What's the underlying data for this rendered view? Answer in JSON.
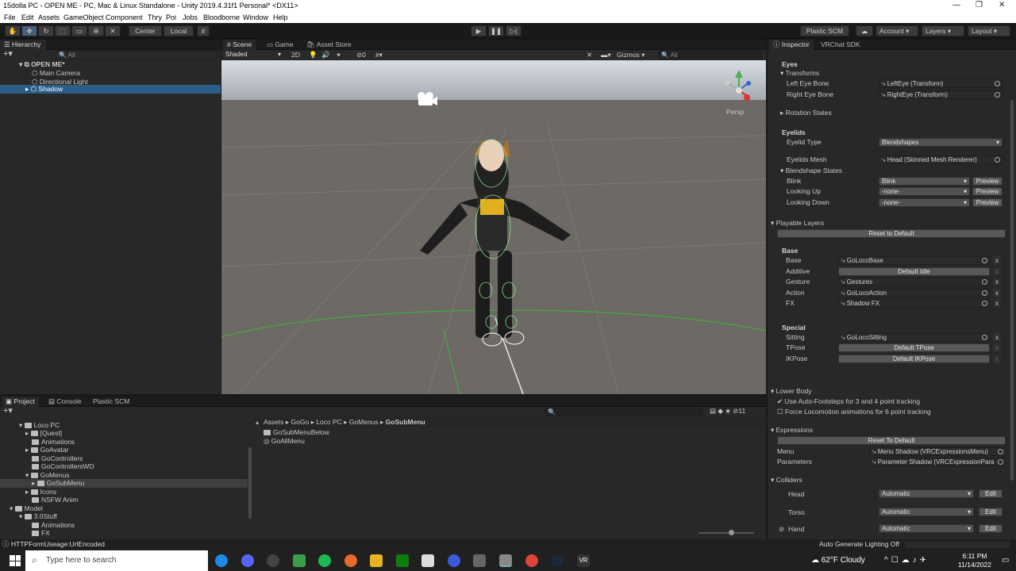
{
  "window": {
    "title": "15dolla PC - OPEN ME - PC, Mac & Linux Standalone - Unity 2019.4.31f1 Personal* <DX11>"
  },
  "menu": [
    "File",
    "Edit",
    "Assets",
    "GameObject",
    "Component",
    "Thry",
    "Poi",
    "Jobs",
    "Bloodborne",
    "Window",
    "Help"
  ],
  "toolbar": {
    "center": "Center",
    "local": "Local",
    "plastic": "Plastic SCM",
    "account": "Account",
    "layers": "Layers",
    "layout": "Layout"
  },
  "hierarchy": {
    "tab": "Hierarchy",
    "search": "All",
    "scene": "OPEN ME*",
    "items": [
      "Main Camera",
      "Directional Light",
      "Shadow"
    ]
  },
  "scene": {
    "tabs": [
      "Scene",
      "Game",
      "Asset Store"
    ],
    "shading": "Shaded",
    "mode2d": "2D",
    "hidden_count": "0",
    "gizmos": "Gizmos",
    "search": "All",
    "persp": "Persp"
  },
  "inspector": {
    "tabs": [
      "Inspector",
      "VRChat SDK"
    ],
    "eyes": {
      "title": "Eyes",
      "transforms": "Transforms",
      "left_label": "Left Eye Bone",
      "left_value": "LeftEye (Transform)",
      "right_label": "Right Eye Bone",
      "right_value": "RightEye (Transform)",
      "rotation": "Rotation States"
    },
    "eyelids": {
      "title": "Eyelids",
      "type_label": "Eyelid Type",
      "type_value": "Blendshapes",
      "mesh_label": "Eyelids Mesh",
      "mesh_value": "Head (Skinned Mesh Renderer)",
      "states": "Blendshape States",
      "rows": [
        {
          "label": "Blink",
          "value": "Blink"
        },
        {
          "label": "Looking Up",
          "value": "-none-"
        },
        {
          "label": "Looking Down",
          "value": "-none-"
        }
      ],
      "preview": "Preview"
    },
    "playable": {
      "title": "Playable Layers",
      "reset": "Reset to Default",
      "base_title": "Base",
      "base": [
        {
          "label": "Base",
          "value": "GoLocoBase"
        },
        {
          "label": "Additive",
          "value": "Default Idle"
        },
        {
          "label": "Gesture",
          "value": "Gestures"
        },
        {
          "label": "Action",
          "value": "GoLocoAction"
        },
        {
          "label": "FX",
          "value": "Shadow FX"
        }
      ],
      "special_title": "Special",
      "special": [
        {
          "label": "Sitting",
          "value": "GoLocoSitting"
        },
        {
          "label": "TPose",
          "value": "Default TPose"
        },
        {
          "label": "IKPose",
          "value": "Default IKPose"
        }
      ]
    },
    "lower": {
      "title": "Lower Body",
      "auto": "Use Auto-Footsteps for 3 and 4 point tracking",
      "force": "Force Locomotion animations for 6 point tracking"
    },
    "expressions": {
      "title": "Expressions",
      "reset": "Reset To Default",
      "menu_label": "Menu",
      "menu_value": "Menu Shadow (VRCExpressionsMenu)",
      "params_label": "Parameters",
      "params_value": "Parameter Shadow (VRCExpressionPara"
    },
    "colliders": {
      "title": "Colliders",
      "rows": [
        {
          "label": "Head",
          "value": "Automatic"
        },
        {
          "label": "Torso",
          "value": "Automatic"
        },
        {
          "label": "Hand",
          "value": "Automatic"
        }
      ],
      "edit": "Edit"
    }
  },
  "project": {
    "tabs": [
      "Project",
      "Console",
      "Plastic SCM"
    ],
    "count": "11",
    "tree": [
      {
        "label": "Loco PC",
        "depth": 1
      },
      {
        "label": "[Quest]",
        "depth": 2
      },
      {
        "label": "Animations",
        "depth": 2
      },
      {
        "label": "GoAvatar",
        "depth": 2
      },
      {
        "label": "GoControllers",
        "depth": 2
      },
      {
        "label": "GoControllersWD",
        "depth": 2
      },
      {
        "label": "GoMenus",
        "depth": 2
      },
      {
        "label": "GoSubMenu",
        "depth": 3
      },
      {
        "label": "Icons",
        "depth": 2
      },
      {
        "label": "NSFW Anim",
        "depth": 2
      },
      {
        "label": "Model",
        "depth": 0
      },
      {
        "label": "3.0Stuff",
        "depth": 1
      },
      {
        "label": "Animations",
        "depth": 2
      },
      {
        "label": "FX",
        "depth": 2
      }
    ],
    "breadcrumb": [
      "Assets",
      "GoGo",
      "Loco PC",
      "GoMenus",
      "GoSubMenu"
    ],
    "files": [
      "GoSubMenuBelow",
      "GoAllMenu"
    ]
  },
  "status": {
    "left": "HTTPFormUseage:UrlEncoded",
    "right": "Auto Generate Lighting Off"
  },
  "taskbar": {
    "search": "Type here to search",
    "weather": "62°F  Cloudy",
    "time": "6:11 PM",
    "date": "11/14/2022"
  }
}
